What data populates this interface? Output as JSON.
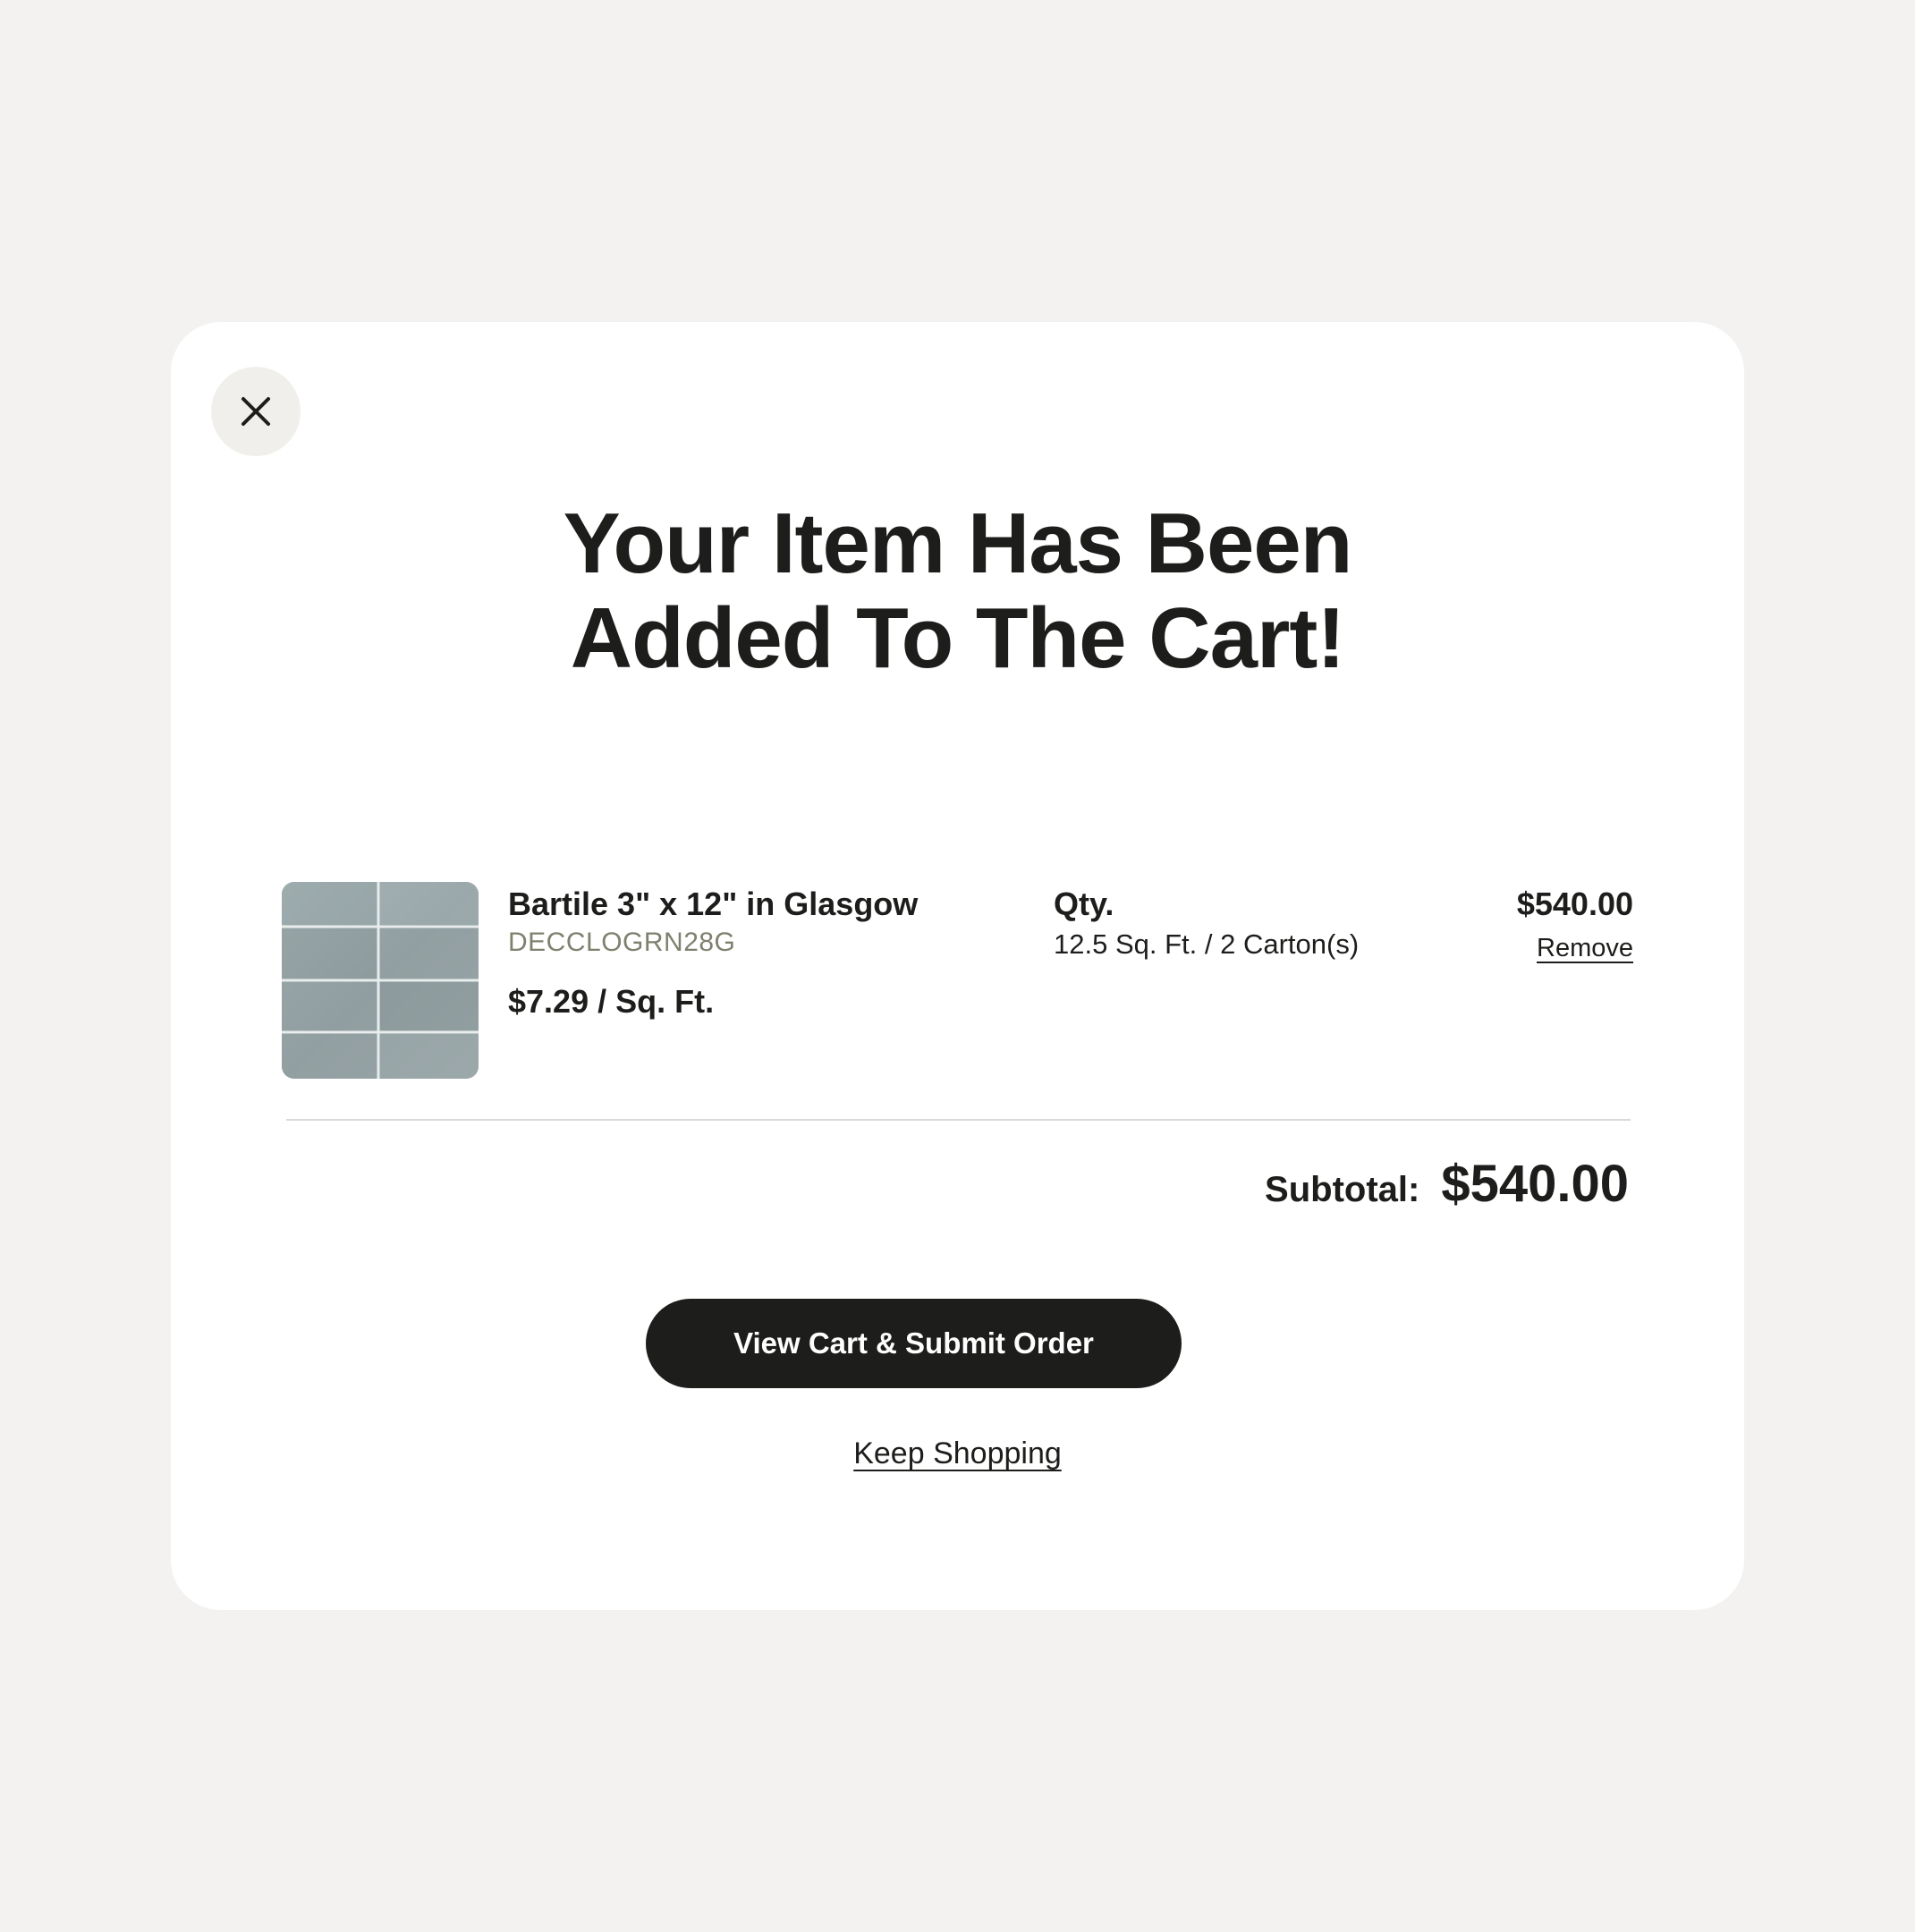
{
  "modal": {
    "title_line1": "Your Item Has Been",
    "title_line2": "Added To The Cart!",
    "close_icon": "close-icon"
  },
  "item": {
    "name": "Bartile 3\" x 12\" in Glasgow",
    "sku": "DECCLOGRN28G",
    "unit_price": "$7.29 / Sq. Ft.",
    "qty_label": "Qty.",
    "qty_value": "12.5 Sq. Ft. / 2 Carton(s)",
    "line_total": "$540.00",
    "remove_label": "Remove"
  },
  "summary": {
    "subtotal_label": "Subtotal:",
    "subtotal_value": "$540.00"
  },
  "actions": {
    "primary_label": "View Cart & Submit Order",
    "secondary_label": "Keep Shopping"
  },
  "colors": {
    "page_background": "#f3f2f0",
    "modal_background": "#ffffff",
    "text": "#1d1d1b",
    "sku_text": "#80806f",
    "button_background": "#1d1d1b",
    "close_button_background": "#f0efec"
  }
}
